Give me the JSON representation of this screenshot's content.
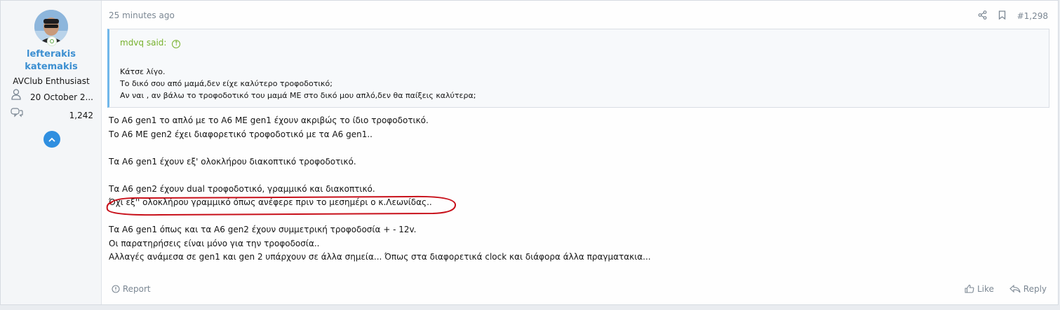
{
  "user": {
    "name_line1": "lefterakis",
    "name_line2": "katemakis",
    "title": "AVClub Enthusiast",
    "joined": "20 October 2...",
    "messages": "1,242"
  },
  "post": {
    "time": "25 minutes ago",
    "number": "#1,298",
    "quote": {
      "author": "mdvq said:",
      "lines": [
        "Κάτσε λίγο.",
        "Το δικό σου από μαμά,δεν είχε καλύτερο τροφοδοτικό;",
        "Αν ναι , αν βάλω το τροφοδοτικό του μαμά ΜΕ στο δικό μου απλό,δεν θα παίξεις καλύτερα;"
      ]
    },
    "message_lines": [
      "Το Α6 gen1 το απλό με το Α6 ΜΕ gen1 έχουν ακριβώς το ίδιο τροφοδοτικό.",
      "Το Α6 ΜΕ gen2 έχει διαφορετικό τροφοδοτικό με τα Α6 gen1..",
      "",
      "Τα Α6 gen1 έχουν εξ' ολοκλήρου διακοπτικό τροφοδοτικό.",
      "",
      "Τα Α6 gen2 έχουν dual τροφοδοτικό, γραμμικό και διακοπτικό.",
      "Όχι εξ'' ολοκλήρου γραμμικό όπως ανέφερε πριν το μεσημέρι ο κ.Λεωνίδας..",
      "",
      "Τα Α6 gen1 όπως και τα Α6 gen2 έχουν συμμετρική τροφοδοσία + - 12v.",
      "Οι παρατηρήσεις είναι μόνο για την τροφοδοσία..",
      "Αλλαγές ανάμεσα σε gen1 και gen 2 υπάρχουν σε άλλα σημεία... Όπως στα διαφορετικά clock και διάφορα άλλα πραγματακια..."
    ],
    "report_label": "Report",
    "like_label": "Like",
    "reply_label": "Reply"
  },
  "colors": {
    "link": "#3c8fd1",
    "quote_author": "#76b12b",
    "annotation": "#c8101a"
  }
}
